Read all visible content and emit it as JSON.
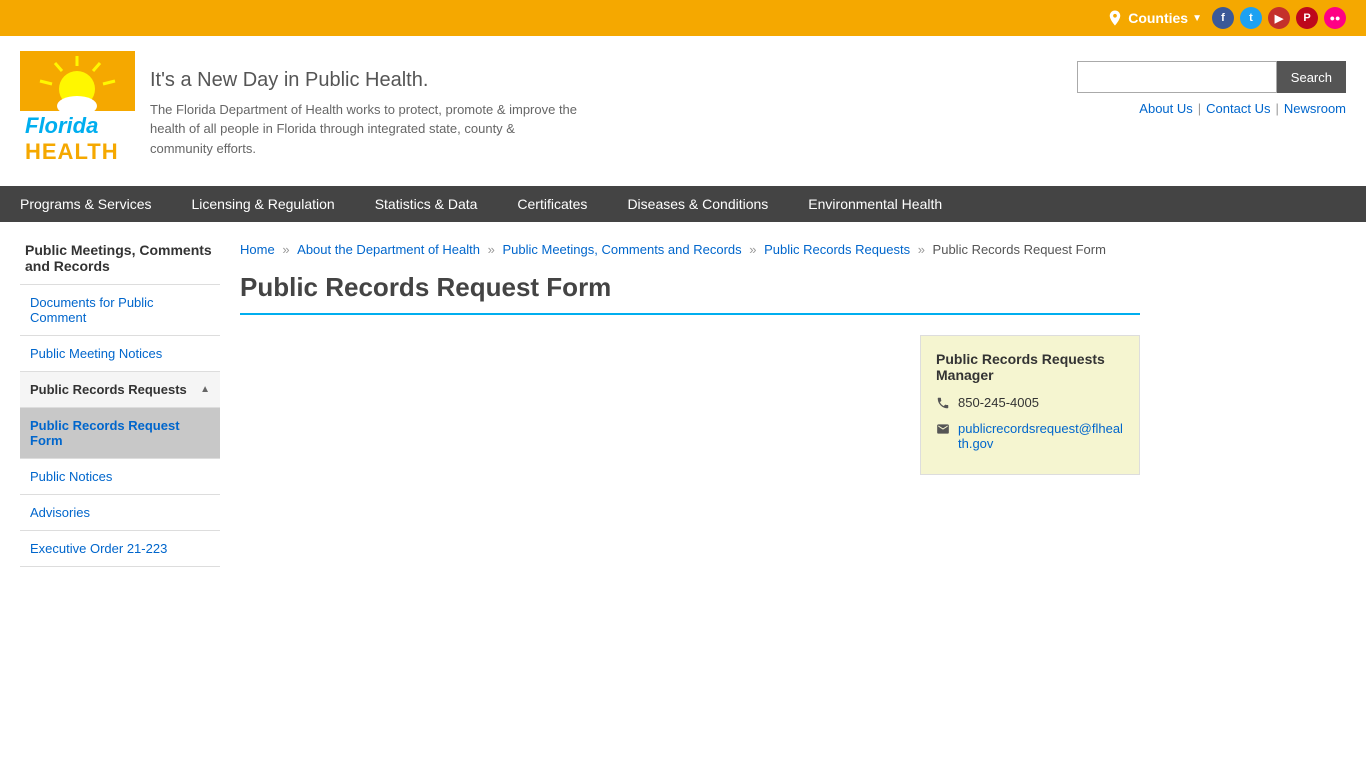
{
  "topbar": {
    "counties_label": "Counties"
  },
  "header": {
    "tagline": "It's a New Day in Public Health.",
    "description": "The Florida Department of Health works to protect, promote & improve the health of all people in Florida through integrated state, county & community efforts.",
    "search_placeholder": "",
    "search_button": "Search",
    "links": {
      "about": "About Us",
      "contact": "Contact Us",
      "newsroom": "Newsroom"
    }
  },
  "nav": {
    "items": [
      "Programs & Services",
      "Licensing & Regulation",
      "Statistics & Data",
      "Certificates",
      "Diseases & Conditions",
      "Environmental Health"
    ]
  },
  "sidebar": {
    "title": "Public Meetings, Comments and Records",
    "items": [
      {
        "label": "Documents for Public Comment",
        "active": false,
        "expanded": false
      },
      {
        "label": "Public Meeting Notices",
        "active": false,
        "expanded": false
      },
      {
        "label": "Public Records Requests",
        "active": true,
        "expanded": true,
        "subitems": [
          {
            "label": "Public Records Request Form",
            "active": true
          }
        ]
      },
      {
        "label": "Public Notices",
        "active": false,
        "expanded": false
      },
      {
        "label": "Advisories",
        "active": false,
        "expanded": false
      },
      {
        "label": "Executive Order 21-223",
        "active": false,
        "expanded": false
      }
    ]
  },
  "breadcrumb": {
    "home": "Home",
    "about": "About the Department of Health",
    "public_meetings": "Public Meetings, Comments and Records",
    "public_records_requests": "Public Records Requests",
    "current": "Public Records Request Form"
  },
  "page": {
    "title": "Public Records Request Form"
  },
  "contact_card": {
    "title": "Public Records Requests Manager",
    "phone": "850-245-4005",
    "email": "publicrecordsrequest@flhealth.gov"
  }
}
